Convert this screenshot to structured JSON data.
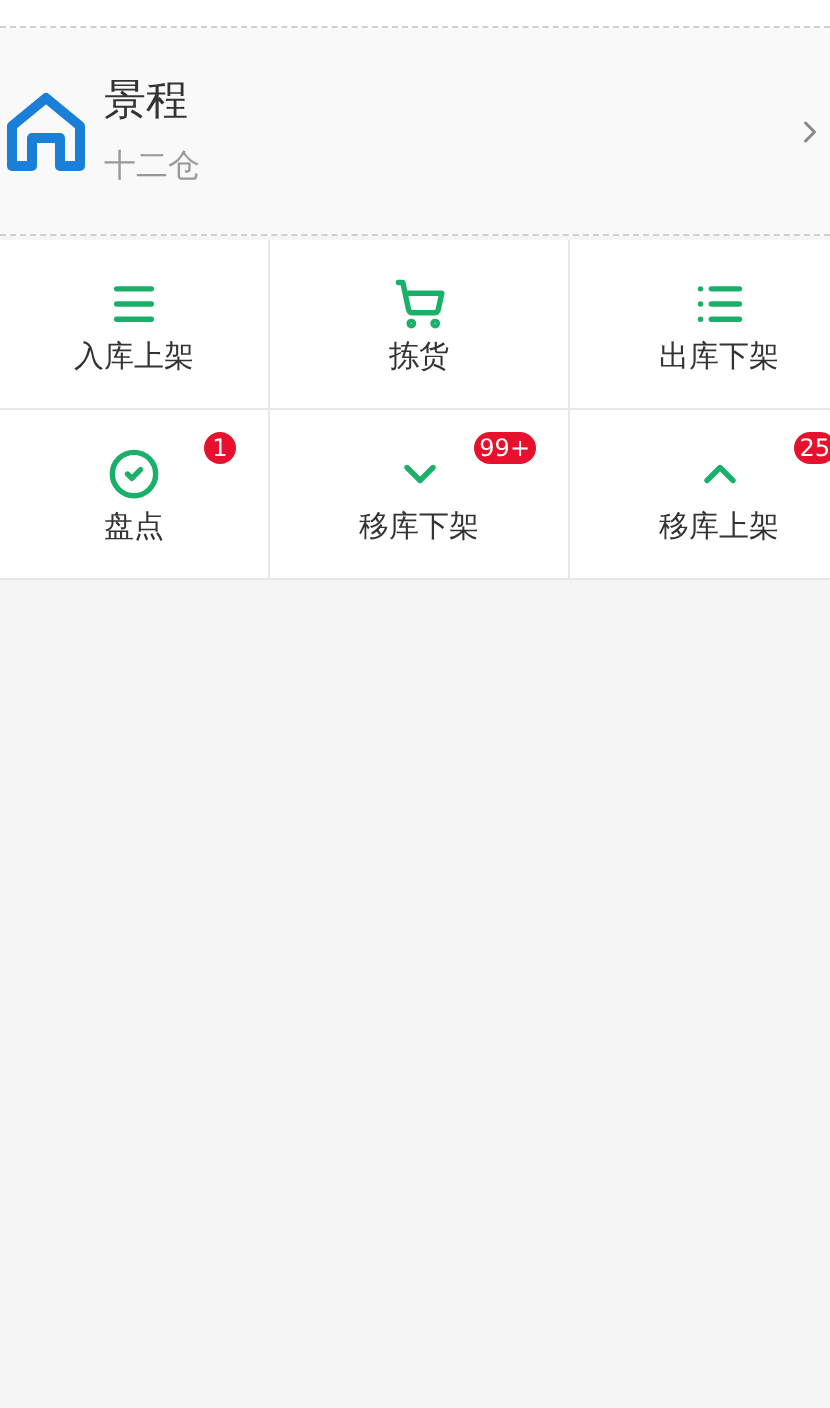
{
  "warehouse": {
    "name": "景程",
    "subtitle": "十二仓"
  },
  "functions": [
    {
      "kind": "menu",
      "label": "入库上架"
    },
    {
      "kind": "cart",
      "label": "拣货"
    },
    {
      "kind": "list",
      "label": "出库下架"
    },
    {
      "kind": "check",
      "label": "盘点",
      "badge": "1"
    },
    {
      "kind": "down",
      "label": "移库下架",
      "badge": "99+"
    },
    {
      "kind": "up",
      "label": "移库上架",
      "badge": "25"
    }
  ]
}
